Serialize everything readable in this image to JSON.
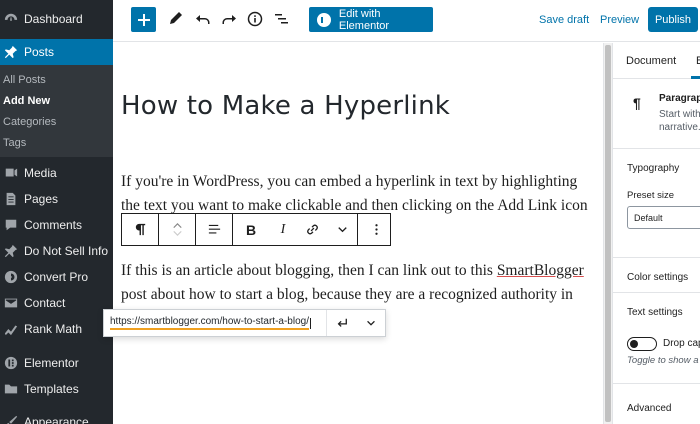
{
  "sidebar": {
    "items": [
      {
        "label": "Dashboard",
        "icon": "dashboard-icon"
      },
      {
        "label": "Posts",
        "icon": "pin-icon",
        "active": true
      },
      {
        "label": "Media",
        "icon": "media-icon"
      },
      {
        "label": "Pages",
        "icon": "pages-icon"
      },
      {
        "label": "Comments",
        "icon": "comments-icon"
      },
      {
        "label": "Do Not Sell Info",
        "icon": "pin-icon"
      },
      {
        "label": "Convert Pro",
        "icon": "convert-pro-icon"
      },
      {
        "label": "Contact",
        "icon": "mail-icon"
      },
      {
        "label": "Rank Math",
        "icon": "chart-icon"
      },
      {
        "label": "Elementor",
        "icon": "elementor-icon"
      },
      {
        "label": "Templates",
        "icon": "folder-icon"
      },
      {
        "label": "Appearance",
        "icon": "brush-icon"
      }
    ],
    "submenu": [
      "All Posts",
      "Add New",
      "Categories",
      "Tags"
    ]
  },
  "toolbar": {
    "elementor_label": "Edit with Elementor",
    "save_draft": "Save draft",
    "preview": "Preview",
    "publish": "Publish"
  },
  "editor": {
    "title": "How to Make a Hyperlink",
    "p1": "If you're in WordPress, you can embed a hyperlink in text by highlighting the text you want to make clickable and then clicking on the Add Link icon or with",
    "p2_before": "If this is an article about blogging, then I can link out to this ",
    "p2_link": "SmartBlogger",
    "p2_after": " post about how to start a blog, because they are a recognized authority in the"
  },
  "link_popover": {
    "url": "https://smartblogger.com/how-to-start-a-blog/"
  },
  "settings": {
    "tab_document": "Document",
    "tab_block": "B",
    "block_title": "Paragraph",
    "block_desc_1": "Start with",
    "block_desc_2": "narrative.",
    "typography": "Typography",
    "preset_size": "Preset size",
    "preset_value": "Default",
    "color_settings": "Color settings",
    "text_settings": "Text settings",
    "drop_cap": "Drop cap",
    "toggle_help": "Toggle to show a",
    "advanced": "Advanced"
  },
  "colors": {
    "accent": "#0073aa",
    "sidebar_bg": "#23282d",
    "submenu_bg": "#32373c"
  }
}
